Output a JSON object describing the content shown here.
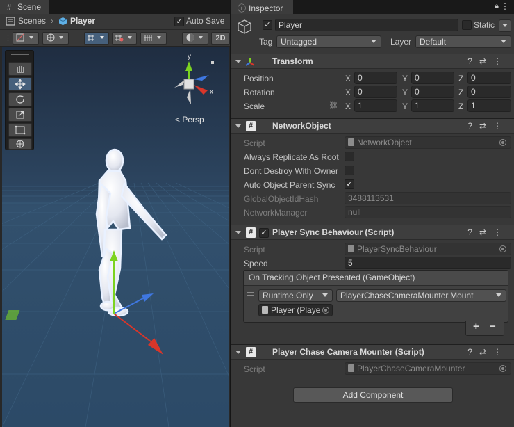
{
  "scene": {
    "tab_label": "Scene",
    "breadcrumb": {
      "root": "Scenes",
      "current": "Player"
    },
    "auto_save_label": "Auto Save",
    "auto_save_checked": true,
    "toolbar": {
      "mode_2d": "2D"
    },
    "persp_label": "Persp",
    "gizmo": {
      "x": "x",
      "y": "y"
    }
  },
  "inspector": {
    "tab_label": "Inspector",
    "object": {
      "active": true,
      "name": "Player",
      "static_label": "Static",
      "tag_label": "Tag",
      "tag_value": "Untagged",
      "layer_label": "Layer",
      "layer_value": "Default"
    },
    "transform": {
      "title": "Transform",
      "rows": [
        {
          "label": "Position",
          "x": "0",
          "y": "0",
          "z": "0"
        },
        {
          "label": "Rotation",
          "x": "0",
          "y": "0",
          "z": "0"
        },
        {
          "label": "Scale",
          "x": "1",
          "y": "1",
          "z": "1"
        }
      ],
      "axis": {
        "x": "X",
        "y": "Y",
        "z": "Z"
      }
    },
    "network_object": {
      "title": "NetworkObject",
      "script_label": "Script",
      "script_value": "NetworkObject",
      "always_replicate_label": "Always Replicate As Root",
      "dont_destroy_label": "Dont Destroy With Owner",
      "auto_parent_label": "Auto Object Parent Sync",
      "global_hash_label": "GlobalObjectIdHash",
      "global_hash_value": "3488113531",
      "network_manager_label": "NetworkManager",
      "network_manager_value": "null"
    },
    "player_sync": {
      "title": "Player Sync Behaviour (Script)",
      "script_label": "Script",
      "script_value": "PlayerSyncBehaviour",
      "speed_label": "Speed",
      "speed_value": "5",
      "event_title": "On Tracking Object Presented (GameObject)",
      "runtime_value": "Runtime Only",
      "function_value": "PlayerChaseCameraMounter.Mount",
      "target_value": "Player (Playe",
      "plus": "+",
      "minus": "−"
    },
    "chase_camera": {
      "title": "Player Chase Camera Mounter (Script)",
      "script_label": "Script",
      "script_value": "PlayerChaseCameraMounter"
    },
    "add_component_label": "Add Component"
  },
  "colors": {
    "viewport_top": "#203045",
    "viewport_bottom": "#2f4f6d",
    "accent_selected": "#46607c",
    "axis_x": "#d8362a",
    "axis_y": "#7cd321",
    "axis_z": "#3f77e0"
  }
}
